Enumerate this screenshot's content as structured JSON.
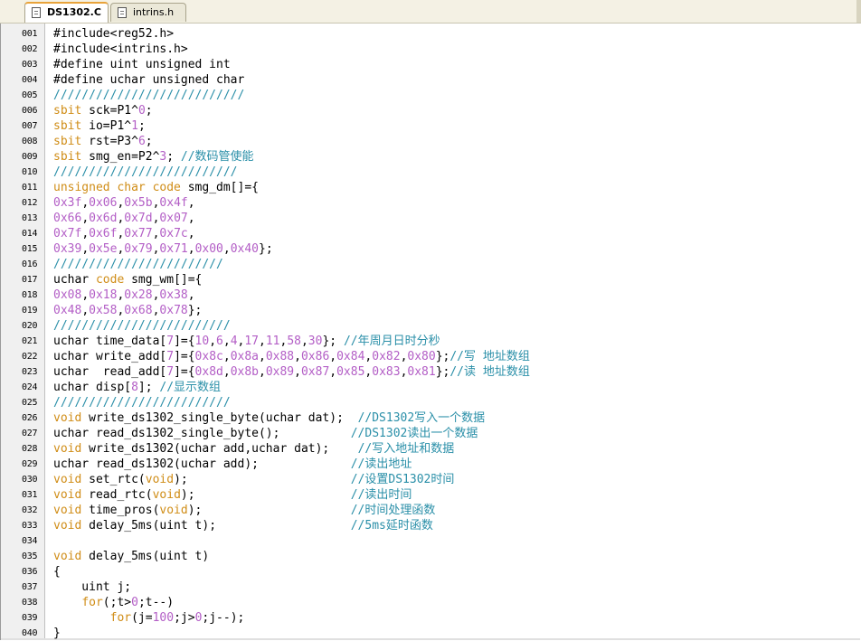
{
  "tabs": [
    {
      "label": "DS1302.C",
      "active": true
    },
    {
      "label": "intrins.h",
      "active": false
    }
  ],
  "colors": {
    "keyword": "#d08d17",
    "number": "#b35ec6",
    "comment": "#2a8fa8",
    "text": "#000000"
  },
  "lines": [
    {
      "no": "001",
      "t": [
        [
          "",
          "#include<reg52.h>"
        ]
      ]
    },
    {
      "no": "002",
      "t": [
        [
          "",
          "#include<intrins.h>"
        ]
      ]
    },
    {
      "no": "003",
      "t": [
        [
          "",
          "#define uint unsigned int"
        ]
      ]
    },
    {
      "no": "004",
      "t": [
        [
          "",
          "#define uchar unsigned char"
        ]
      ]
    },
    {
      "no": "005",
      "t": [
        [
          "c",
          "///////////////////////////"
        ]
      ]
    },
    {
      "no": "006",
      "t": [
        [
          "k",
          "sbit"
        ],
        [
          "",
          " sck=P1^"
        ],
        [
          "n",
          "0"
        ],
        [
          "",
          ";"
        ]
      ]
    },
    {
      "no": "007",
      "t": [
        [
          "k",
          "sbit"
        ],
        [
          "",
          " io=P1^"
        ],
        [
          "n",
          "1"
        ],
        [
          "",
          ";"
        ]
      ]
    },
    {
      "no": "008",
      "t": [
        [
          "k",
          "sbit"
        ],
        [
          "",
          " rst=P3^"
        ],
        [
          "n",
          "6"
        ],
        [
          "",
          ";"
        ]
      ]
    },
    {
      "no": "009",
      "t": [
        [
          "k",
          "sbit"
        ],
        [
          "",
          " smg_en=P2^"
        ],
        [
          "n",
          "3"
        ],
        [
          "",
          "; "
        ],
        [
          "c",
          "//数码管使能"
        ]
      ]
    },
    {
      "no": "010",
      "t": [
        [
          "c",
          "//////////////////////////"
        ]
      ]
    },
    {
      "no": "011",
      "t": [
        [
          "k",
          "unsigned char code"
        ],
        [
          "",
          " smg_dm[]={"
        ]
      ]
    },
    {
      "no": "012",
      "t": [
        [
          "n",
          "0x3f"
        ],
        [
          "",
          ","
        ],
        [
          "n",
          "0x06"
        ],
        [
          "",
          ","
        ],
        [
          "n",
          "0x5b"
        ],
        [
          "",
          ","
        ],
        [
          "n",
          "0x4f"
        ],
        [
          "",
          ","
        ]
      ]
    },
    {
      "no": "013",
      "t": [
        [
          "n",
          "0x66"
        ],
        [
          "",
          ","
        ],
        [
          "n",
          "0x6d"
        ],
        [
          "",
          ","
        ],
        [
          "n",
          "0x7d"
        ],
        [
          "",
          ","
        ],
        [
          "n",
          "0x07"
        ],
        [
          "",
          ","
        ]
      ]
    },
    {
      "no": "014",
      "t": [
        [
          "n",
          "0x7f"
        ],
        [
          "",
          ","
        ],
        [
          "n",
          "0x6f"
        ],
        [
          "",
          ","
        ],
        [
          "n",
          "0x77"
        ],
        [
          "",
          ","
        ],
        [
          "n",
          "0x7c"
        ],
        [
          "",
          ","
        ]
      ]
    },
    {
      "no": "015",
      "t": [
        [
          "n",
          "0x39"
        ],
        [
          "",
          ","
        ],
        [
          "n",
          "0x5e"
        ],
        [
          "",
          ","
        ],
        [
          "n",
          "0x79"
        ],
        [
          "",
          ","
        ],
        [
          "n",
          "0x71"
        ],
        [
          "",
          ","
        ],
        [
          "n",
          "0x00"
        ],
        [
          "",
          ","
        ],
        [
          "n",
          "0x40"
        ],
        [
          "",
          "};"
        ]
      ]
    },
    {
      "no": "016",
      "t": [
        [
          "c",
          "////////////////////////"
        ]
      ]
    },
    {
      "no": "017",
      "t": [
        [
          "",
          "uchar "
        ],
        [
          "k",
          "code"
        ],
        [
          "",
          " smg_wm[]={"
        ]
      ]
    },
    {
      "no": "018",
      "t": [
        [
          "n",
          "0x08"
        ],
        [
          "",
          ","
        ],
        [
          "n",
          "0x18"
        ],
        [
          "",
          ","
        ],
        [
          "n",
          "0x28"
        ],
        [
          "",
          ","
        ],
        [
          "n",
          "0x38"
        ],
        [
          "",
          ","
        ]
      ]
    },
    {
      "no": "019",
      "t": [
        [
          "n",
          "0x48"
        ],
        [
          "",
          ","
        ],
        [
          "n",
          "0x58"
        ],
        [
          "",
          ","
        ],
        [
          "n",
          "0x68"
        ],
        [
          "",
          ","
        ],
        [
          "n",
          "0x78"
        ],
        [
          "",
          "};"
        ]
      ]
    },
    {
      "no": "020",
      "t": [
        [
          "c",
          "/////////////////////////"
        ]
      ]
    },
    {
      "no": "021",
      "t": [
        [
          "",
          "uchar time_data["
        ],
        [
          "n",
          "7"
        ],
        [
          "",
          "]={"
        ],
        [
          "n",
          "10"
        ],
        [
          "",
          ","
        ],
        [
          "n",
          "6"
        ],
        [
          "",
          ","
        ],
        [
          "n",
          "4"
        ],
        [
          "",
          ","
        ],
        [
          "n",
          "17"
        ],
        [
          "",
          ","
        ],
        [
          "n",
          "11"
        ],
        [
          "",
          ","
        ],
        [
          "n",
          "58"
        ],
        [
          "",
          ","
        ],
        [
          "n",
          "30"
        ],
        [
          "",
          "}; "
        ],
        [
          "c",
          "//年周月日时分秒"
        ]
      ]
    },
    {
      "no": "022",
      "t": [
        [
          "",
          "uchar write_add["
        ],
        [
          "n",
          "7"
        ],
        [
          "",
          "]={"
        ],
        [
          "n",
          "0x8c"
        ],
        [
          "",
          ","
        ],
        [
          "n",
          "0x8a"
        ],
        [
          "",
          ","
        ],
        [
          "n",
          "0x88"
        ],
        [
          "",
          ","
        ],
        [
          "n",
          "0x86"
        ],
        [
          "",
          ","
        ],
        [
          "n",
          "0x84"
        ],
        [
          "",
          ","
        ],
        [
          "n",
          "0x82"
        ],
        [
          "",
          ","
        ],
        [
          "n",
          "0x80"
        ],
        [
          "",
          "};"
        ],
        [
          "c",
          "//写 地址数组"
        ]
      ]
    },
    {
      "no": "023",
      "t": [
        [
          "",
          "uchar  read_add["
        ],
        [
          "n",
          "7"
        ],
        [
          "",
          "]={"
        ],
        [
          "n",
          "0x8d"
        ],
        [
          "",
          ","
        ],
        [
          "n",
          "0x8b"
        ],
        [
          "",
          ","
        ],
        [
          "n",
          "0x89"
        ],
        [
          "",
          ","
        ],
        [
          "n",
          "0x87"
        ],
        [
          "",
          ","
        ],
        [
          "n",
          "0x85"
        ],
        [
          "",
          ","
        ],
        [
          "n",
          "0x83"
        ],
        [
          "",
          ","
        ],
        [
          "n",
          "0x81"
        ],
        [
          "",
          "};"
        ],
        [
          "c",
          "//读 地址数组"
        ]
      ]
    },
    {
      "no": "024",
      "t": [
        [
          "",
          "uchar disp["
        ],
        [
          "n",
          "8"
        ],
        [
          "",
          "]; "
        ],
        [
          "c",
          "//显示数组"
        ]
      ]
    },
    {
      "no": "025",
      "t": [
        [
          "c",
          "/////////////////////////"
        ]
      ]
    },
    {
      "no": "026",
      "t": [
        [
          "k",
          "void"
        ],
        [
          "",
          " write_ds1302_single_byte(uchar dat);  "
        ],
        [
          "c",
          "//DS1302写入一个数据"
        ]
      ]
    },
    {
      "no": "027",
      "t": [
        [
          "",
          "uchar read_ds1302_single_byte();          "
        ],
        [
          "c",
          "//DS1302读出一个数据"
        ]
      ]
    },
    {
      "no": "028",
      "t": [
        [
          "k",
          "void"
        ],
        [
          "",
          " write_ds1302(uchar add,uchar dat);    "
        ],
        [
          "c",
          "//写入地址和数据"
        ]
      ]
    },
    {
      "no": "029",
      "t": [
        [
          "",
          "uchar read_ds1302(uchar add);             "
        ],
        [
          "c",
          "//读出地址"
        ]
      ]
    },
    {
      "no": "030",
      "t": [
        [
          "k",
          "void"
        ],
        [
          "",
          " set_rtc("
        ],
        [
          "k",
          "void"
        ],
        [
          "",
          ");                       "
        ],
        [
          "c",
          "//设置DS1302时间"
        ]
      ]
    },
    {
      "no": "031",
      "t": [
        [
          "k",
          "void"
        ],
        [
          "",
          " read_rtc("
        ],
        [
          "k",
          "void"
        ],
        [
          "",
          ");                      "
        ],
        [
          "c",
          "//读出时间"
        ]
      ]
    },
    {
      "no": "032",
      "t": [
        [
          "k",
          "void"
        ],
        [
          "",
          " time_pros("
        ],
        [
          "k",
          "void"
        ],
        [
          "",
          ");                     "
        ],
        [
          "c",
          "//时间处理函数"
        ]
      ]
    },
    {
      "no": "033",
      "t": [
        [
          "k",
          "void"
        ],
        [
          "",
          " delay_5ms(uint t);                   "
        ],
        [
          "c",
          "//5ms延时函数"
        ]
      ]
    },
    {
      "no": "034",
      "t": []
    },
    {
      "no": "035",
      "t": [
        [
          "k",
          "void"
        ],
        [
          "",
          " delay_5ms(uint t)"
        ]
      ]
    },
    {
      "no": "036",
      "t": [
        [
          "",
          "{"
        ]
      ]
    },
    {
      "no": "037",
      "t": [
        [
          "",
          "    uint j;"
        ]
      ]
    },
    {
      "no": "038",
      "t": [
        [
          "",
          "    "
        ],
        [
          "k",
          "for"
        ],
        [
          "",
          "(;t>"
        ],
        [
          "n",
          "0"
        ],
        [
          "",
          ";t--)"
        ]
      ]
    },
    {
      "no": "039",
      "t": [
        [
          "",
          "        "
        ],
        [
          "k",
          "for"
        ],
        [
          "",
          "(j="
        ],
        [
          "n",
          "100"
        ],
        [
          "",
          ";j>"
        ],
        [
          "n",
          "0"
        ],
        [
          "",
          ";j--);"
        ]
      ]
    },
    {
      "no": "040",
      "t": [
        [
          "",
          "}"
        ]
      ]
    }
  ]
}
